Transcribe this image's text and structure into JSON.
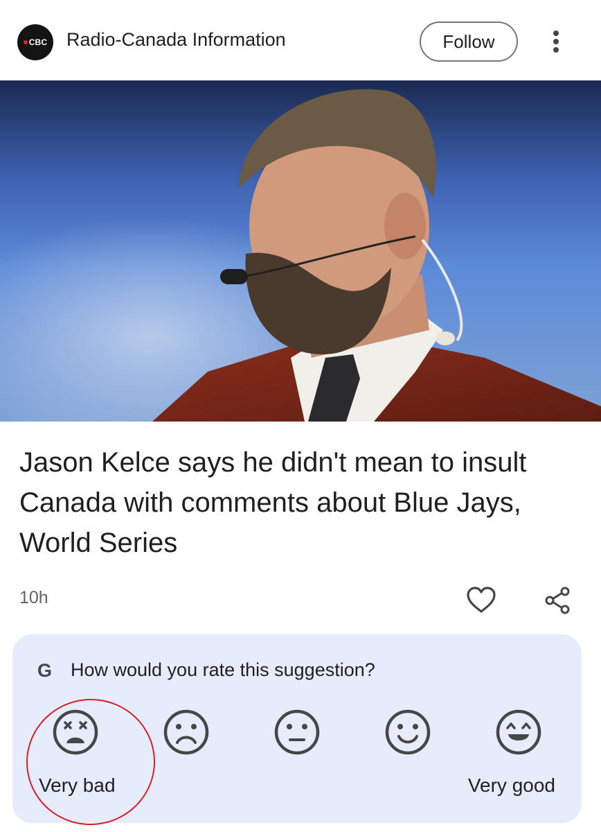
{
  "header": {
    "logo_text": "CBC",
    "publisher": "Radio-Canada Information",
    "follow_label": "Follow",
    "more_icon": "more-vert-icon"
  },
  "hero_image": {
    "description_icon": "photo-bearded-man-with-microphone"
  },
  "article": {
    "headline": "Jason Kelce says he didn't mean to insult Canada with comments about Blue Jays, World Series",
    "age": "10h",
    "like_icon": "heart-icon",
    "share_icon": "share-icon"
  },
  "rating": {
    "brand_letter": "G",
    "question": "How would you rate this suggestion?",
    "options": [
      {
        "icon": "very-bad-face-icon"
      },
      {
        "icon": "bad-face-icon"
      },
      {
        "icon": "neutral-face-icon"
      },
      {
        "icon": "good-face-icon"
      },
      {
        "icon": "very-good-face-icon"
      }
    ],
    "low_label": "Very bad",
    "high_label": "Very good"
  },
  "colors": {
    "card_background": "#e6ecfb",
    "annotation": "#d61f26",
    "icon": "#444746"
  }
}
